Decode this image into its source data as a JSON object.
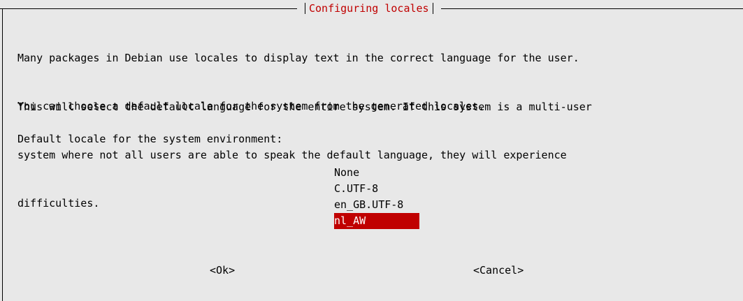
{
  "dialog": {
    "title": "Configuring locales",
    "paragraph1": [
      "Many packages in Debian use locales to display text in the correct language for the user.",
      "You can choose a default locale for the system from the generated locales."
    ],
    "paragraph2": [
      "This will select the default language for the entire system. If this system is a multi-user",
      "system where not all users are able to speak the default language, they will experience",
      "difficulties."
    ],
    "prompt": "Default locale for the system environment:",
    "options": [
      "None",
      "C.UTF-8",
      "en_GB.UTF-8",
      "nl_AW"
    ],
    "selected_option": "nl_AW",
    "ok_label": "<Ok>",
    "cancel_label": "<Cancel>"
  },
  "colors": {
    "background": "#e8e8e8",
    "title": "#c00000",
    "selection_bg": "#c00000",
    "selection_fg": "#ffffff"
  }
}
